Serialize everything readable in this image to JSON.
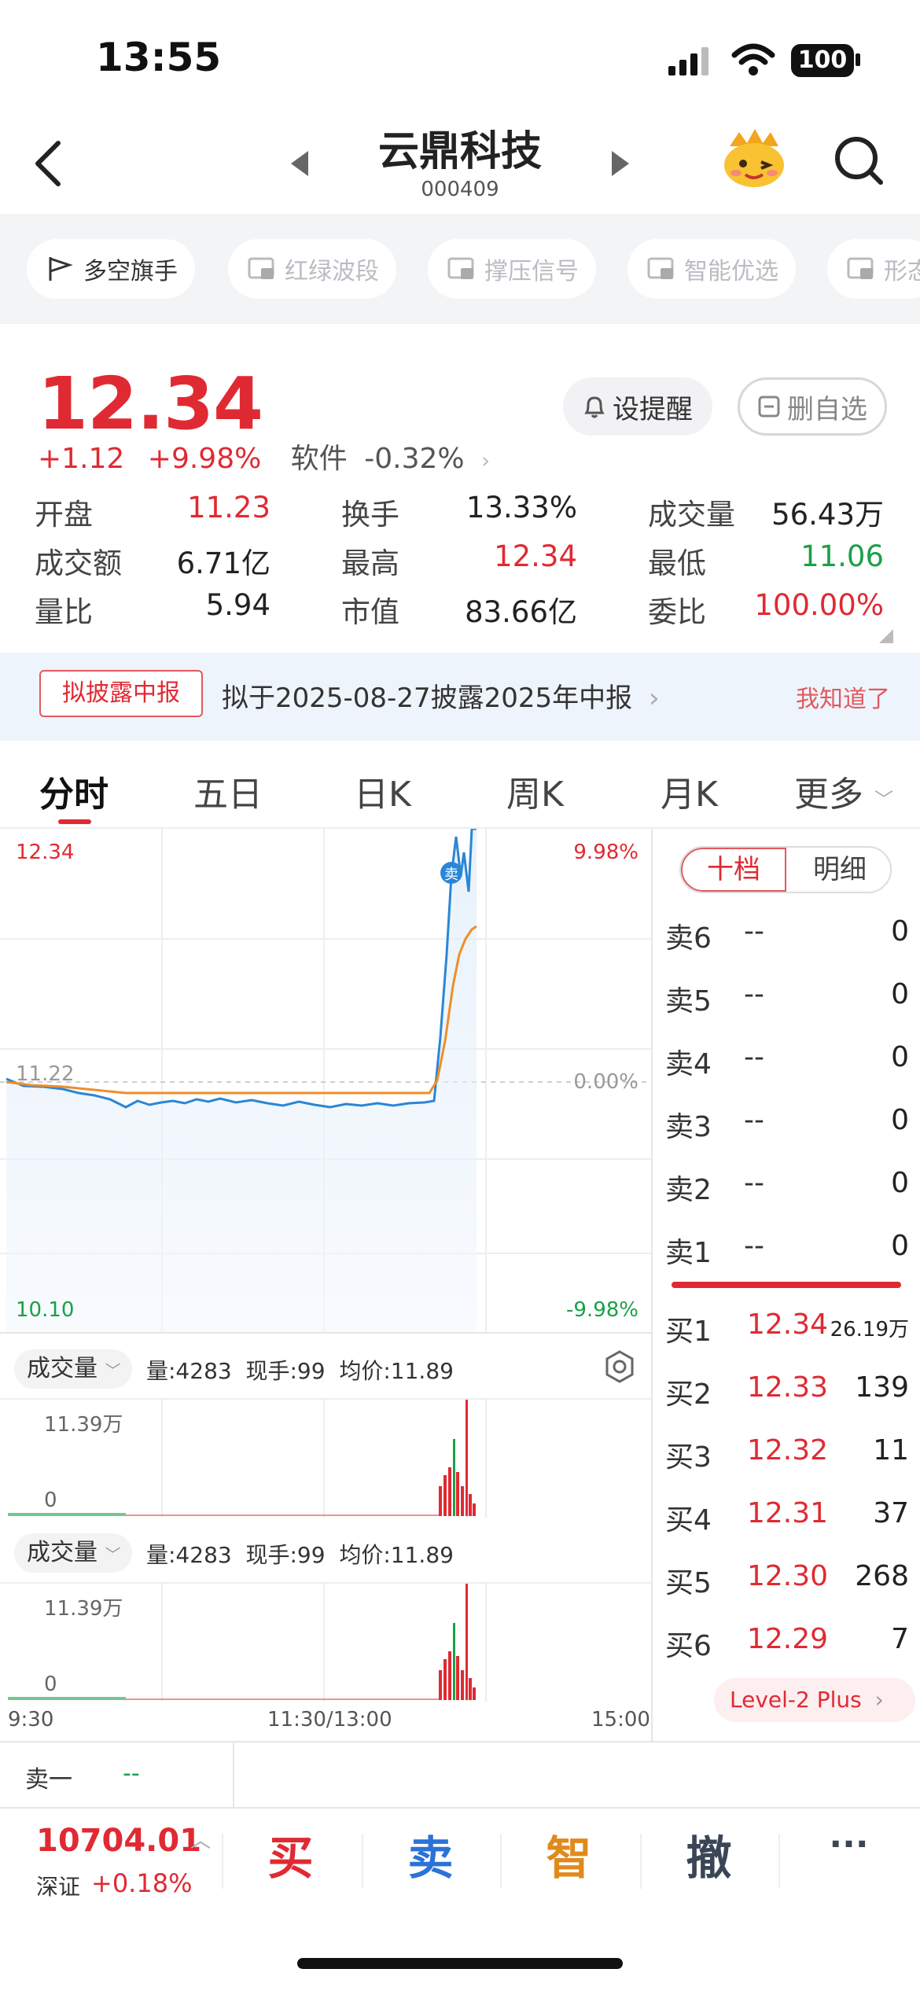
{
  "status": {
    "time": "13:55",
    "battery": "100"
  },
  "header": {
    "name": "云鼎科技",
    "code": "000409"
  },
  "toolbar": [
    "多空旗手",
    "红绿波段",
    "撑压信号",
    "智能优选",
    "形态"
  ],
  "quote": {
    "price": "12.34",
    "change": "+1.12",
    "change_pct": "+9.98%",
    "sector": "软件",
    "sector_pct": "-0.32%",
    "alert_label": "设提醒",
    "watch_label": "删自选"
  },
  "stats": [
    {
      "label": "开盘",
      "value": "11.23",
      "color": "#e02a33"
    },
    {
      "label": "换手",
      "value": "13.33%",
      "color": "#222222"
    },
    {
      "label": "成交量",
      "value": "56.43万",
      "color": "#222222"
    },
    {
      "label": "成交额",
      "value": "6.71亿",
      "color": "#222222"
    },
    {
      "label": "最高",
      "value": "12.34",
      "color": "#e02a33"
    },
    {
      "label": "最低",
      "value": "11.06",
      "color": "#1aa049"
    },
    {
      "label": "量比",
      "value": "5.94",
      "color": "#222222"
    },
    {
      "label": "市值",
      "value": "83.66亿",
      "color": "#222222"
    },
    {
      "label": "委比",
      "value": "100.00%",
      "color": "#e02a33"
    }
  ],
  "notice": {
    "tag": "拟披露中报",
    "text": "拟于2025-08-27披露2025年中报",
    "dismiss": "我知道了"
  },
  "tabs": [
    "分时",
    "五日",
    "日K",
    "周K",
    "月K",
    "更多"
  ],
  "chart": {
    "y_high": "12.34",
    "y_high_pct": "9.98%",
    "y_mid": "11.22",
    "y_mid_pct": "0.00%",
    "y_low": "10.10",
    "y_low_pct": "-9.98%",
    "sell_marker": "卖",
    "x_start": "9:30",
    "x_mid": "11:30/13:00",
    "x_end": "15:00"
  },
  "volume_panels": [
    {
      "title": "成交量",
      "info": "量:4283  现手:99  均价:11.89",
      "max": "11.39万",
      "zero": "0"
    },
    {
      "title": "成交量",
      "info": "量:4283  现手:99  均价:11.89",
      "max": "11.39万",
      "zero": "0"
    }
  ],
  "orderbook": {
    "tab_active": "十档",
    "tab_inactive": "明细",
    "asks": [
      {
        "label": "卖6",
        "price": "--",
        "vol": "0"
      },
      {
        "label": "卖5",
        "price": "--",
        "vol": "0"
      },
      {
        "label": "卖4",
        "price": "--",
        "vol": "0"
      },
      {
        "label": "卖3",
        "price": "--",
        "vol": "0"
      },
      {
        "label": "卖2",
        "price": "--",
        "vol": "0"
      },
      {
        "label": "卖1",
        "price": "--",
        "vol": "0"
      }
    ],
    "bids": [
      {
        "label": "买1",
        "price": "12.34",
        "vol": "26.19万"
      },
      {
        "label": "买2",
        "price": "12.33",
        "vol": "139"
      },
      {
        "label": "买3",
        "price": "12.32",
        "vol": "11"
      },
      {
        "label": "买4",
        "price": "12.31",
        "vol": "37"
      },
      {
        "label": "买5",
        "price": "12.30",
        "vol": "268"
      },
      {
        "label": "买6",
        "price": "12.29",
        "vol": "7"
      }
    ],
    "level2": "Level-2 Plus"
  },
  "sell_one": {
    "label": "卖一",
    "value": "--"
  },
  "index": {
    "value": "10704.01",
    "name": "深证",
    "pct": "+0.18%"
  },
  "actions": [
    {
      "label": "买",
      "color": "#e02a33"
    },
    {
      "label": "卖",
      "color": "#2a72d6"
    },
    {
      "label": "智",
      "color": "#e08a1e"
    },
    {
      "label": "撤",
      "color": "#3a4656"
    },
    {
      "label": "···",
      "color": "#3a4656"
    }
  ]
}
